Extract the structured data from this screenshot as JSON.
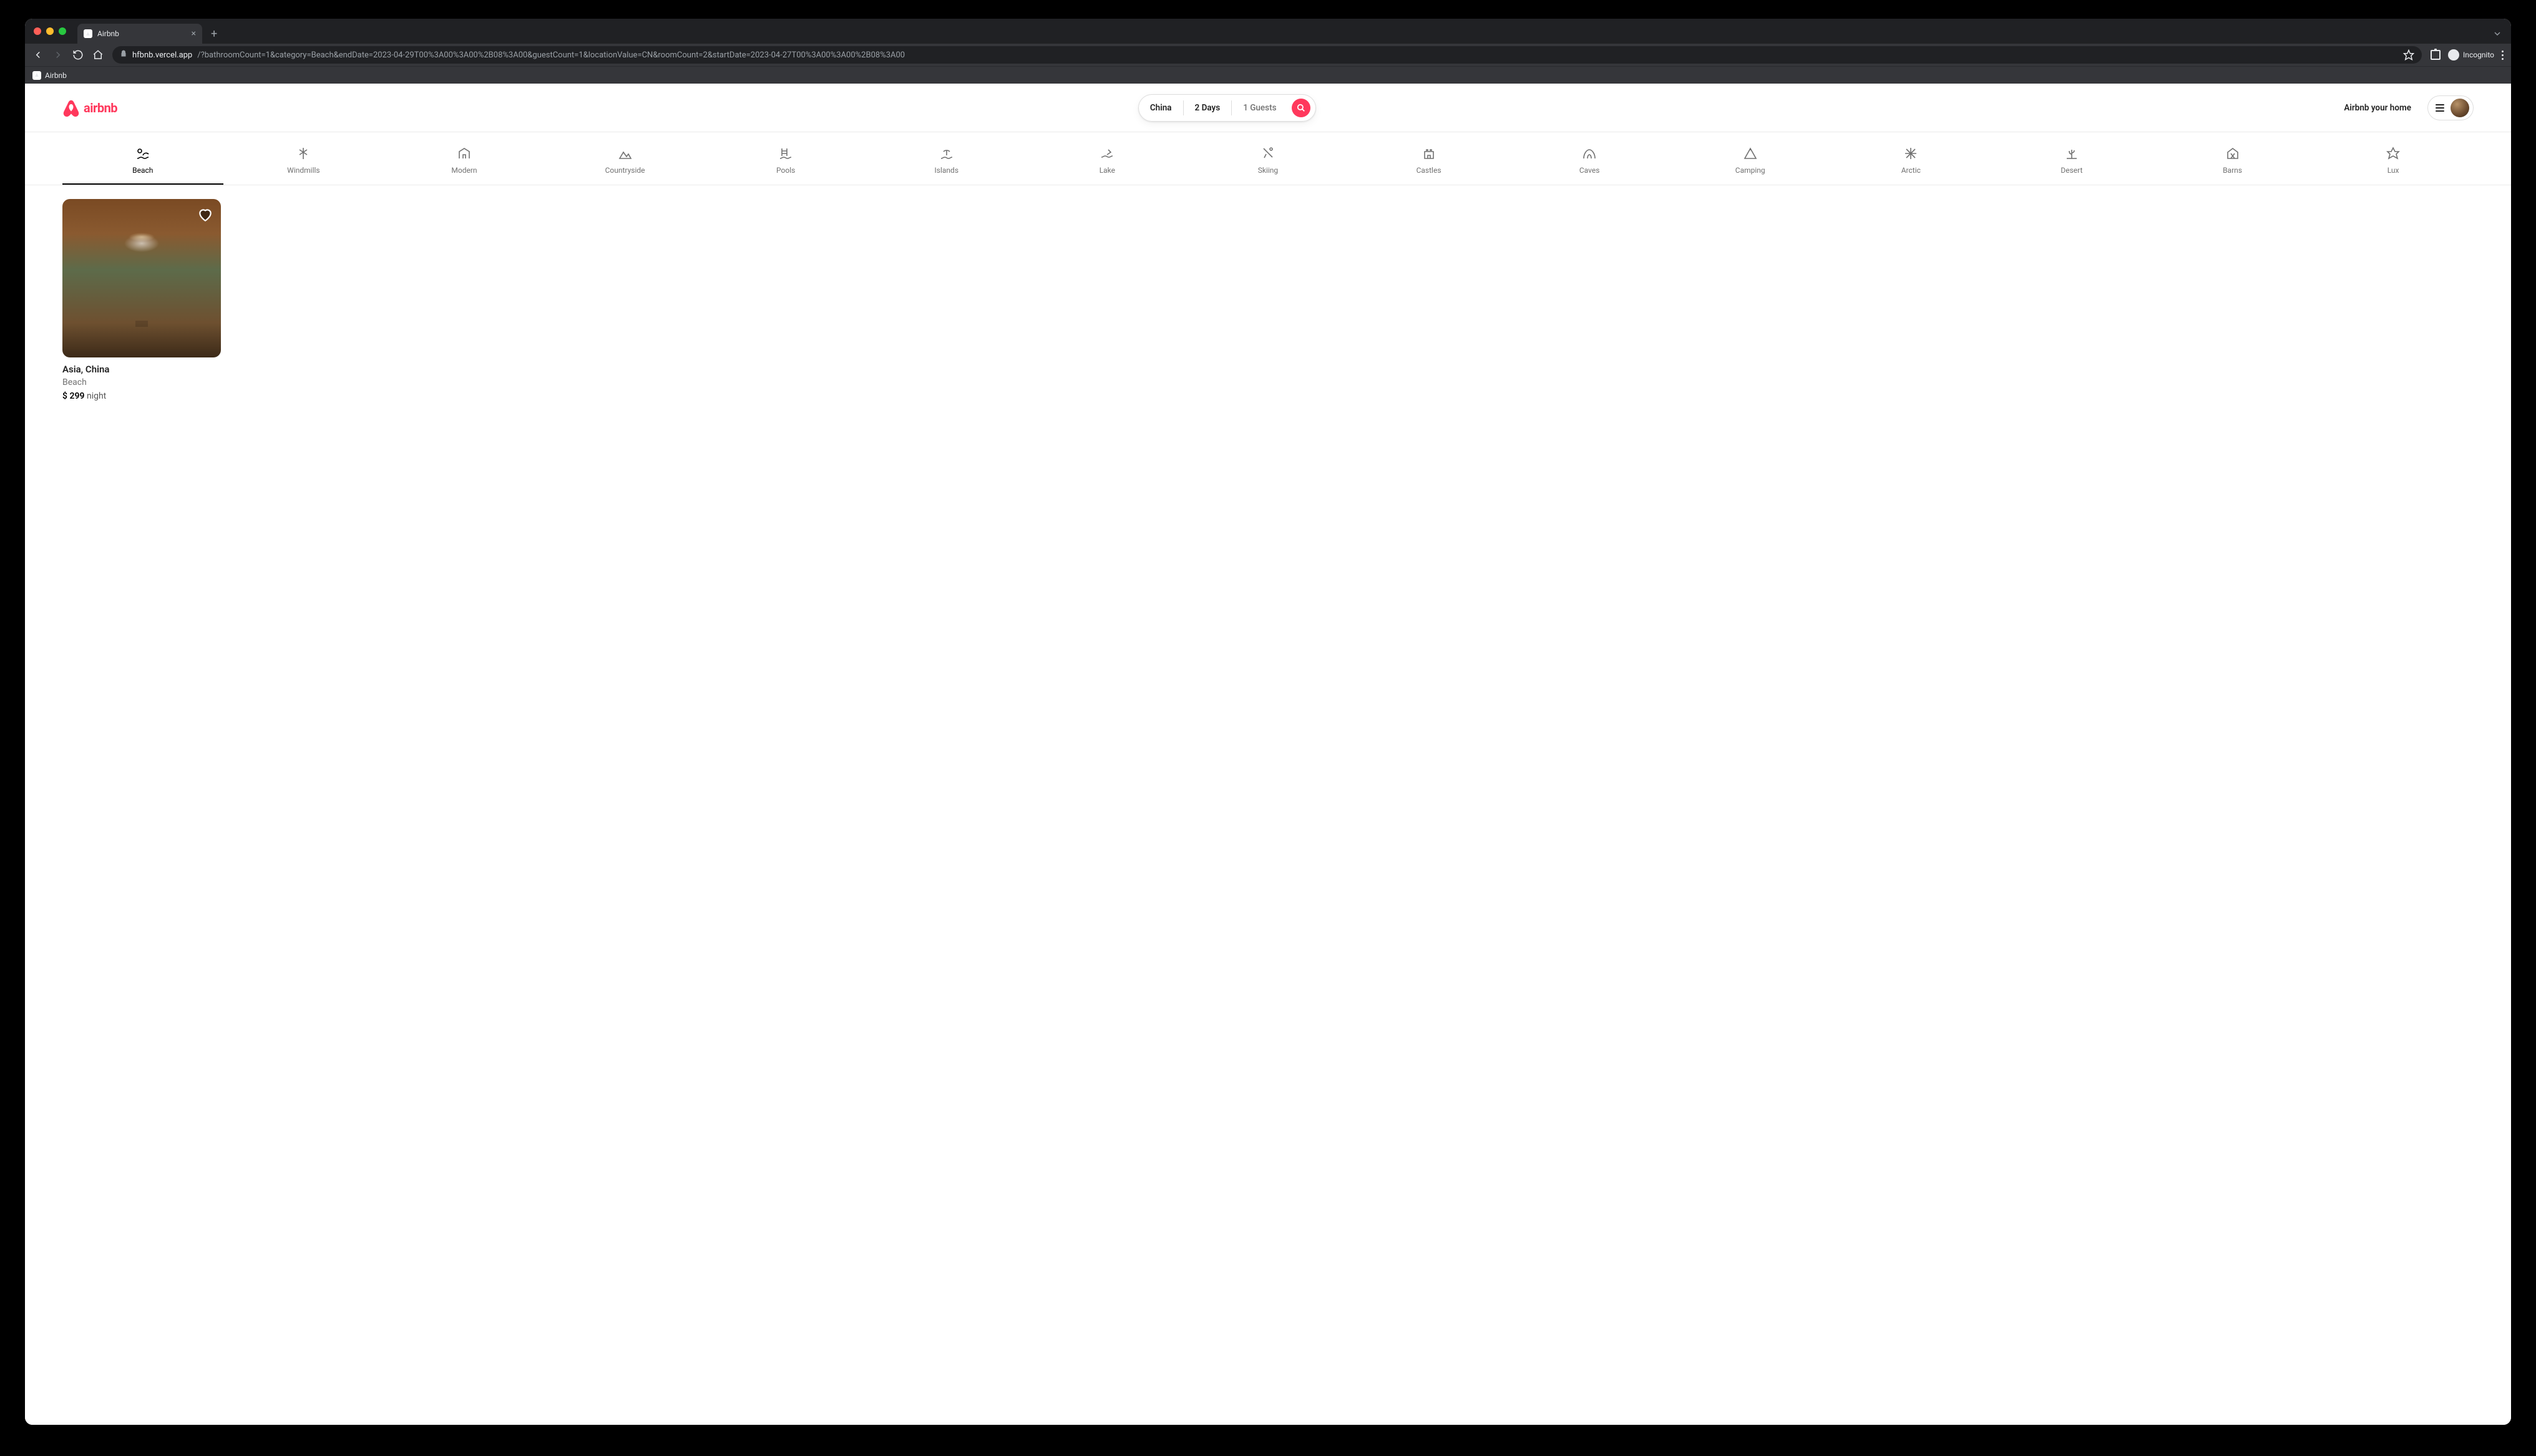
{
  "browser": {
    "tab_title": "Airbnb",
    "url_host": "hfbnb.vercel.app",
    "url_path": "/?bathroomCount=1&category=Beach&endDate=2023-04-29T00%3A00%3A00%2B08%3A00&guestCount=1&locationValue=CN&roomCount=2&startDate=2023-04-27T00%3A00%3A00%2B08%3A00",
    "incognito_label": "Incognito",
    "bookmark_label": "Airbnb"
  },
  "header": {
    "brand": "airbnb",
    "search": {
      "location": "China",
      "duration": "2 Days",
      "guests": "1 Guests"
    },
    "host_link": "Airbnb your home"
  },
  "categories": [
    {
      "key": "beach",
      "label": "Beach",
      "active": true
    },
    {
      "key": "windmills",
      "label": "Windmills",
      "active": false
    },
    {
      "key": "modern",
      "label": "Modern",
      "active": false
    },
    {
      "key": "countryside",
      "label": "Countryside",
      "active": false
    },
    {
      "key": "pools",
      "label": "Pools",
      "active": false
    },
    {
      "key": "islands",
      "label": "Islands",
      "active": false
    },
    {
      "key": "lake",
      "label": "Lake",
      "active": false
    },
    {
      "key": "skiing",
      "label": "Skiing",
      "active": false
    },
    {
      "key": "castles",
      "label": "Castles",
      "active": false
    },
    {
      "key": "caves",
      "label": "Caves",
      "active": false
    },
    {
      "key": "camping",
      "label": "Camping",
      "active": false
    },
    {
      "key": "arctic",
      "label": "Arctic",
      "active": false
    },
    {
      "key": "desert",
      "label": "Desert",
      "active": false
    },
    {
      "key": "barns",
      "label": "Barns",
      "active": false
    },
    {
      "key": "lux",
      "label": "Lux",
      "active": false
    }
  ],
  "listings": [
    {
      "title": "Asia, China",
      "subtitle": "Beach",
      "price": "$ 299",
      "price_unit": "night"
    }
  ]
}
